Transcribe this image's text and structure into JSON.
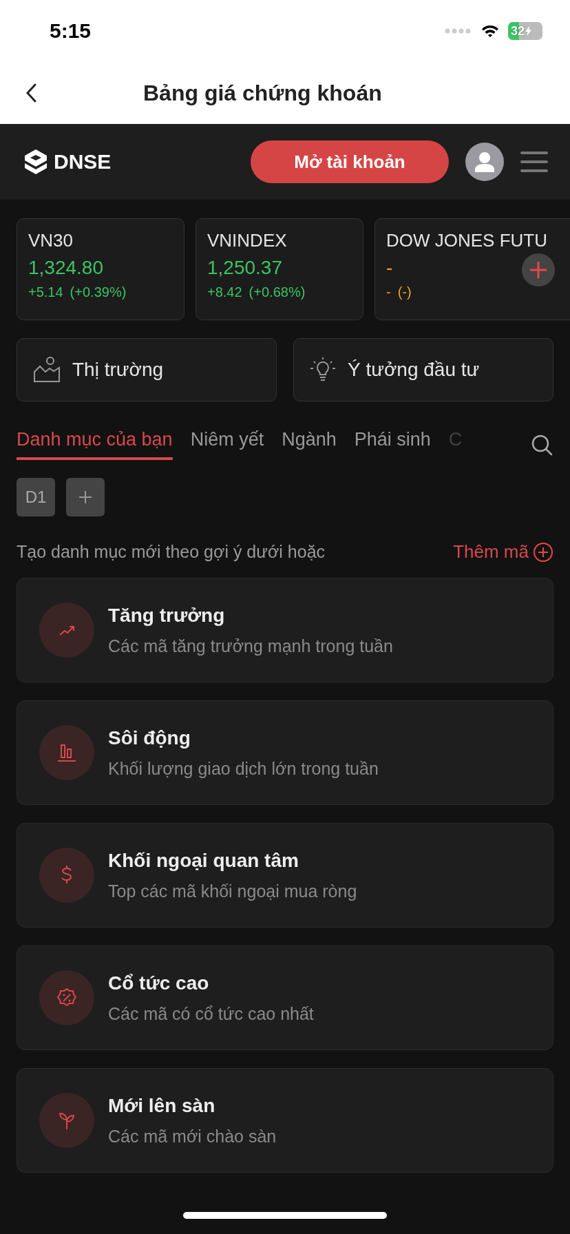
{
  "status_bar": {
    "time": "5:15",
    "battery": "32"
  },
  "nav": {
    "title": "Bảng giá chứng khoán"
  },
  "header": {
    "logo": "DNSE",
    "open_account": "Mở tài khoản"
  },
  "indices": [
    {
      "name": "VN30",
      "price": "1,324.80",
      "change": "+5.14",
      "percent": "(+0.39%)",
      "color": "#3cc463"
    },
    {
      "name": "VNINDEX",
      "price": "1,250.37",
      "change": "+8.42",
      "percent": "(+0.68%)",
      "color": "#3cc463"
    },
    {
      "name": "DOW JONES FUTU",
      "price": "-",
      "change": "-",
      "percent": "(-)",
      "color": "#f0a020"
    }
  ],
  "quick_links": [
    {
      "label": "Thị trường",
      "kind": "market"
    },
    {
      "label": "Ý tưởng đầu tư",
      "kind": "idea"
    }
  ],
  "tabs": [
    {
      "label": "Danh mục của bạn",
      "selected": true
    },
    {
      "label": "Niêm yết",
      "selected": false
    },
    {
      "label": "Ngành",
      "selected": false
    },
    {
      "label": "Phái sinh",
      "selected": false
    },
    {
      "label": "C",
      "selected": false
    }
  ],
  "watchlists": [
    {
      "label": "D1"
    }
  ],
  "hint": "Tạo danh mục mới theo gợi ý dưới hoặc",
  "add_symbol": "Thêm mã",
  "suggestions": [
    {
      "kind": "growth",
      "title": "Tăng trưởng",
      "subtitle": "Các mã tăng trưởng mạnh trong tuần"
    },
    {
      "kind": "volume",
      "title": "Sôi động",
      "subtitle": "Khối lượng giao dịch lớn trong tuần"
    },
    {
      "kind": "foreign",
      "title": "Khối ngoại quan tâm",
      "subtitle": "Top các mã khối ngoại mua ròng"
    },
    {
      "kind": "dividend",
      "title": "Cổ tức cao",
      "subtitle": "Các mã có cổ tức cao nhất"
    },
    {
      "kind": "new",
      "title": "Mới lên sàn",
      "subtitle": "Các mã mới chào sàn"
    }
  ]
}
